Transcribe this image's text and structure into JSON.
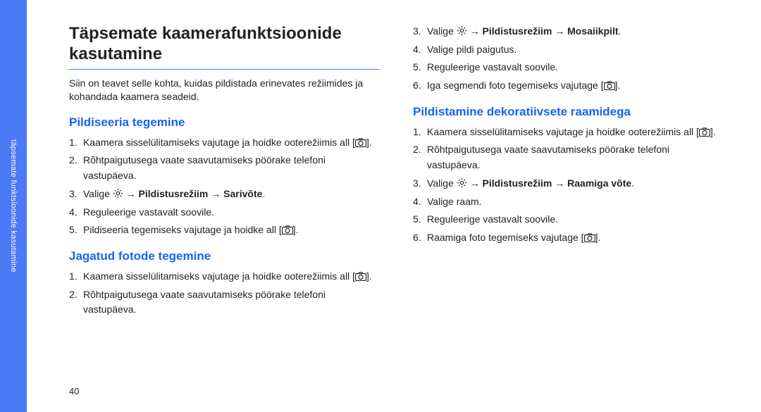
{
  "sidebar": {
    "label": "täpsemate funktsioonide kasutamine"
  },
  "page_number": "40",
  "title": "Täpsemate kaamerafunktsioonide kasutamine",
  "intro": "Siin on teavet selle kohta, kuidas pildistada erinevates režiimides ja kohandada kaamera seadeid.",
  "sections": [
    {
      "heading": "Pildiseeria tegemine",
      "items": [
        {
          "n": "1.",
          "pre": "Kaamera sisselülitamiseks vajutage ja hoidke ooterežiimis all [",
          "icon": "camera",
          "post": "]."
        },
        {
          "n": "2.",
          "pre": "Rõhtpaigutusega vaate saavutamiseks pöörake telefoni vastupäeva."
        },
        {
          "n": "3.",
          "pre": "Valige ",
          "icon": "gear",
          "post_bold": " → Pildistusrežiim → Sarivõte",
          "tail": "."
        },
        {
          "n": "4.",
          "pre": "Reguleerige vastavalt soovile."
        },
        {
          "n": "5.",
          "pre": "Pildiseeria tegemiseks vajutage ja hoidke all [",
          "icon": "camera",
          "post": "]."
        }
      ]
    },
    {
      "heading": "Jagatud fotode tegemine",
      "items": [
        {
          "n": "1.",
          "pre": "Kaamera sisselülitamiseks vajutage ja hoidke ooterežiimis all [",
          "icon": "camera",
          "post": "]."
        },
        {
          "n": "2.",
          "pre": "Rõhtpaigutusega vaate saavutamiseks pöörake telefoni vastupäeva."
        }
      ]
    }
  ],
  "right_items_top": [
    {
      "n": "3.",
      "pre": "Valige ",
      "icon": "gear",
      "post_bold": " → Pildistusrežiim → Mosaiikpilt",
      "tail": "."
    },
    {
      "n": "4.",
      "pre": "Valige pildi paigutus."
    },
    {
      "n": "5.",
      "pre": "Reguleerige vastavalt soovile."
    },
    {
      "n": "6.",
      "pre": "Iga segmendi foto tegemiseks vajutage [",
      "icon": "camera",
      "post": "]."
    }
  ],
  "right_section": {
    "heading": "Pildistamine dekoratiivsete raamidega",
    "items": [
      {
        "n": "1.",
        "pre": "Kaamera sisselülitamiseks vajutage ja hoidke ooterežiimis all [",
        "icon": "camera",
        "post": "]."
      },
      {
        "n": "2.",
        "pre": "Rõhtpaigutusega vaate saavutamiseks pöörake telefoni vastupäeva."
      },
      {
        "n": "3.",
        "pre": "Valige ",
        "icon": "gear",
        "post_bold": " → Pildistusrežiim → Raamiga võte",
        "tail": "."
      },
      {
        "n": "4.",
        "pre": "Valige raam."
      },
      {
        "n": "5.",
        "pre": "Reguleerige vastavalt soovile."
      },
      {
        "n": "6.",
        "pre": "Raamiga foto tegemiseks vajutage [",
        "icon": "camera",
        "post": "]."
      }
    ]
  }
}
